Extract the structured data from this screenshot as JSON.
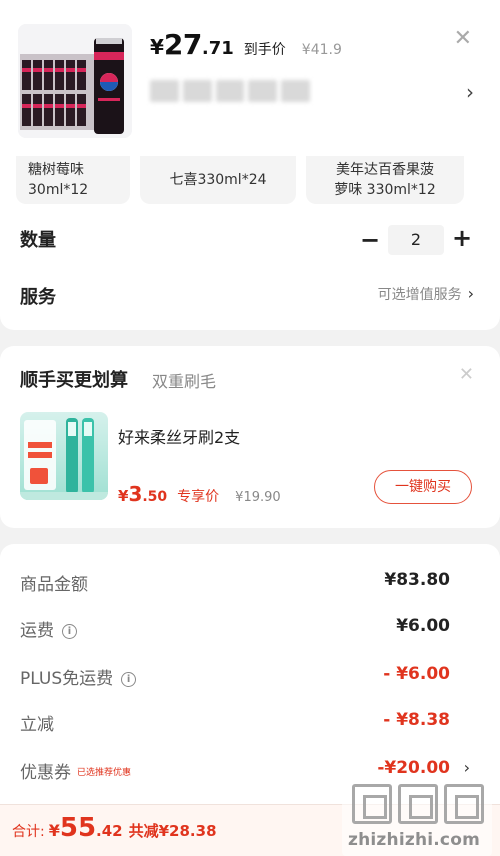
{
  "product": {
    "price_symbol": "¥",
    "price_int": "27",
    "price_dec": ".71",
    "price_tag": "到手价",
    "original_price": "¥41.9"
  },
  "variants": [
    {
      "label": "糖树莓味\n30ml*12"
    },
    {
      "label": "七喜330ml*24"
    },
    {
      "label": "美年达百香果菠\n萝味 330ml*12"
    }
  ],
  "quantity": {
    "label": "数量",
    "value": "2",
    "minus": "−",
    "plus": "+"
  },
  "service": {
    "label": "服务",
    "value": "可选增值服务"
  },
  "recommend": {
    "title": "顺手买更划算",
    "subtitle": "双重刷毛",
    "item_name": "好来柔丝牙刷2支",
    "price_symbol": "¥",
    "price_int": "3",
    "price_dec": ".50",
    "price_tag": "专享价",
    "original_price": "¥19.90",
    "buy_label": "一键购买"
  },
  "summary": {
    "goods_label": "商品金额",
    "goods_value": "¥83.80",
    "shipping_label": "运费",
    "shipping_value": "¥6.00",
    "plus_label": "PLUS免运费",
    "plus_value": "- ¥6.00",
    "discount_label": "立减",
    "discount_value": "- ¥8.38",
    "coupon_label": "优惠券",
    "coupon_tag": "已选推荐优惠",
    "coupon_value": "-¥20.00"
  },
  "bottom": {
    "total_label": "合计:",
    "total_symbol": "¥",
    "total_int": "55",
    "total_dec": ".42",
    "save_text": "共减¥28.38"
  },
  "watermark": {
    "text": "zhizhizhi.com"
  },
  "colors": {
    "accent": "#e0341e",
    "background": "#f2f2f2"
  },
  "icons": [
    "close-icon",
    "chevron-right-icon",
    "minus-icon",
    "plus-icon",
    "info-icon"
  ]
}
